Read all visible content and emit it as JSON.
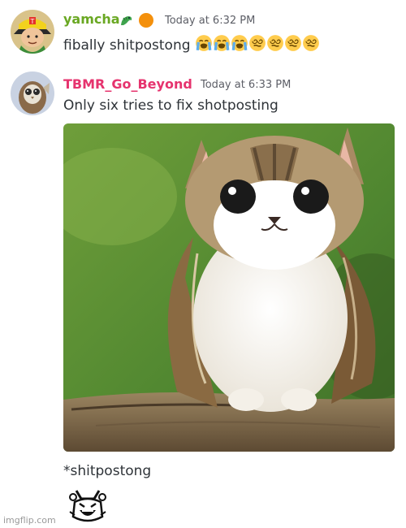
{
  "messages": [
    {
      "username": "yamcha",
      "username_color": "#6aa823",
      "badges": [
        "dragon-emoji",
        "orange-circle-emoji"
      ],
      "timestamp": "Today at 6:32 PM",
      "text": "fibally  shitpostong",
      "trailing_emojis": [
        "loudly-crying-face",
        "loudly-crying-face",
        "loudly-crying-face",
        "face-with-spiral-eyes",
        "face-with-spiral-eyes",
        "face-with-spiral-eyes",
        "face-with-spiral-eyes"
      ]
    },
    {
      "username": "TBMR_Go_Beyond",
      "username_color": "#e6336e",
      "timestamp": "Today at 6:33 PM",
      "text": "Only six tries to fix shotposting",
      "attachment": "cat-owl-image"
    },
    {
      "text": "*shitpostong",
      "sticker": "laughing-creature-sticker"
    }
  ],
  "watermark": "imgflip.com"
}
